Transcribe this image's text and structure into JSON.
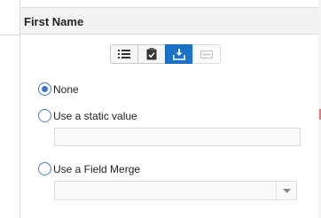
{
  "panel": {
    "title": "First Name"
  },
  "toolbar": {
    "buttons": [
      {
        "icon": "list-icon",
        "state": "normal"
      },
      {
        "icon": "clipboard-check-icon",
        "state": "normal"
      },
      {
        "icon": "inbox-download-icon",
        "state": "active"
      },
      {
        "icon": "text-field-icon",
        "state": "disabled"
      }
    ],
    "active_color": "#1a73c8"
  },
  "options": {
    "none_label": "None",
    "static_label": "Use a static value",
    "merge_label": "Use a Field Merge",
    "selected": "None"
  },
  "static_value": {
    "value": "",
    "placeholder": ""
  },
  "field_merge": {
    "selected": ""
  }
}
